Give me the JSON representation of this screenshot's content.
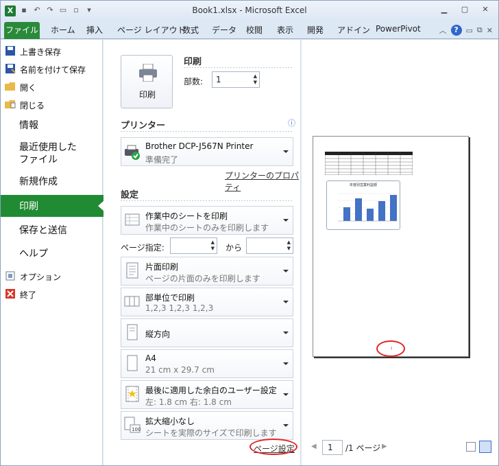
{
  "window": {
    "title": "Book1.xlsx - Microsoft Excel",
    "app_icon": "X"
  },
  "ribbon": {
    "tabs": [
      "ファイル",
      "ホーム",
      "挿入",
      "ページ レイアウト",
      "数式",
      "データ",
      "校閲",
      "表示",
      "開発",
      "アドイン",
      "PowerPivot"
    ]
  },
  "nav": {
    "small_top": [
      "上書き保存",
      "名前を付けて保存",
      "開く",
      "閉じる"
    ],
    "large": [
      "情報",
      "最近使用した",
      "ファイル",
      "新規作成",
      "印刷",
      "保存と送信",
      "ヘルプ"
    ],
    "small_bottom": [
      "オプション",
      "終了"
    ]
  },
  "print": {
    "section_title": "印刷",
    "button_label": "印刷",
    "copies_label": "部数:",
    "copies_value": "1"
  },
  "printer": {
    "section_title": "プリンター",
    "name": "Brother DCP-J567N Printer",
    "status": "準備完了",
    "properties_link": "プリンターのプロパティ"
  },
  "settings": {
    "section_title": "設定",
    "sheet": {
      "title": "作業中のシートを印刷",
      "sub": "作業中のシートのみを印刷します"
    },
    "pages_label": "ページ指定:",
    "to_label": "から",
    "sides": {
      "title": "片面印刷",
      "sub": "ページの片面のみを印刷します"
    },
    "collate": {
      "title": "部単位で印刷",
      "sub": "1,2,3    1,2,3    1,2,3"
    },
    "orientation": {
      "title": "縦方向"
    },
    "paper": {
      "title": "A4",
      "sub": "21 cm x 29.7 cm"
    },
    "margins": {
      "title": "最後に適用した余白のユーザー設定",
      "sub": "左:  1.8 cm    右:  1.8 cm"
    },
    "scaling": {
      "title": "拡大縮小なし",
      "sub": "シートを実際のサイズで印刷します"
    },
    "page_setup_link": "ページ設定"
  },
  "preview": {
    "page_number": "1",
    "page_total": "/1 ページ",
    "chart_title": "年度別営業利益額",
    "footer_number": "1"
  },
  "colors": {
    "accent_green": "#218b33",
    "highlight_red": "#e02424",
    "bar_blue": "#4472c4"
  }
}
